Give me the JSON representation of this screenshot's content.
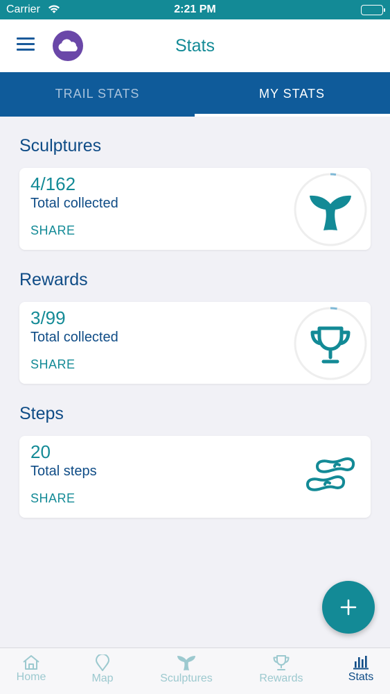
{
  "status_bar": {
    "carrier": "Carrier",
    "time": "2:21 PM"
  },
  "header": {
    "title": "Stats"
  },
  "tabs": [
    {
      "label": "TRAIL STATS",
      "active": false
    },
    {
      "label": "MY STATS",
      "active": true
    }
  ],
  "sections": [
    {
      "title": "Sculptures",
      "value": "4/162",
      "label": "Total collected",
      "share": "SHARE",
      "icon": "whale-tail-icon",
      "progress": 0.025
    },
    {
      "title": "Rewards",
      "value": "3/99",
      "label": "Total collected",
      "share": "SHARE",
      "icon": "trophy-icon",
      "progress": 0.03
    },
    {
      "title": "Steps",
      "value": "20",
      "label": "Total steps",
      "share": "SHARE",
      "icon": "footprints-icon"
    }
  ],
  "fab": {
    "icon": "plus-icon"
  },
  "bottom_nav": [
    {
      "label": "Home",
      "icon": "home-icon",
      "active": false
    },
    {
      "label": "Map",
      "icon": "map-pin-icon",
      "active": false
    },
    {
      "label": "Sculptures",
      "icon": "whale-tail-icon",
      "active": false
    },
    {
      "label": "Rewards",
      "icon": "trophy-icon",
      "active": false
    },
    {
      "label": "Stats",
      "icon": "bar-chart-icon",
      "active": true
    }
  ],
  "colors": {
    "teal": "#138a96",
    "navy": "#0f4c86",
    "tab_bar": "#0f5b9a",
    "avatar": "#6a47a8",
    "inactive_nav": "#9cc9cf"
  }
}
